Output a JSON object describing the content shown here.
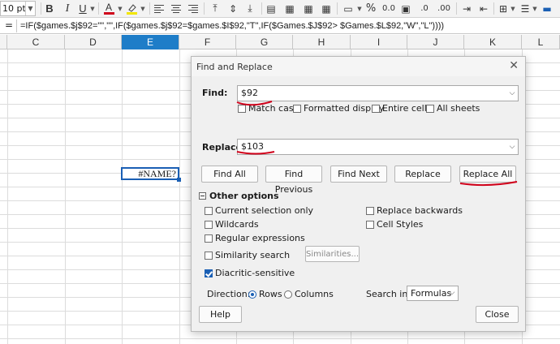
{
  "toolbar": {
    "font_size": "10 pt",
    "bold": "B",
    "italic": "I",
    "underline": "U",
    "font_color_letter": "A",
    "percent": "%",
    "decimal_format": "0.0",
    "decimal_add": ".0",
    "decimal_remove": ".00"
  },
  "formula_bar": {
    "equals": "=",
    "formula": "=IF($games.$j$92=\"\",\"\",IF($games.$j$92=$games.$I$92,\"T\",IF($Games.$J$92> $Games.$L$92,\"W\",\"L\"))))"
  },
  "columns": [
    "C",
    "D",
    "E",
    "F",
    "G",
    "H",
    "I",
    "J",
    "K",
    "L"
  ],
  "active_column": "E",
  "cell": {
    "value": "#NAME?"
  },
  "dialog": {
    "title": "Find and Replace",
    "find_label": "Find:",
    "find_value": "$92",
    "replace_label": "Replace:",
    "replace_value": "$103",
    "checkboxes": {
      "match_case": "Match case",
      "formatted_display": "Formatted display",
      "entire_cells": "Entire cells",
      "all_sheets": "All sheets"
    },
    "buttons": {
      "find_all": "Find All",
      "find_previous": "Find Previous",
      "find_next": "Find Next",
      "replace": "Replace",
      "replace_all": "Replace All",
      "similarities": "Similarities...",
      "help": "Help",
      "close": "Close"
    },
    "other_options": {
      "title": "Other options",
      "current_selection_only": "Current selection only",
      "wildcards": "Wildcards",
      "regular_expressions": "Regular expressions",
      "similarity_search": "Similarity search",
      "diacritic_sensitive": "Diacritic-sensitive",
      "replace_backwards": "Replace backwards",
      "cell_styles": "Cell Styles"
    },
    "direction": {
      "label": "Direction:",
      "rows": "Rows",
      "columns": "Columns",
      "selected": "Rows"
    },
    "search_in": {
      "label": "Search in:",
      "value": "Formulas"
    }
  },
  "colors": {
    "accent": "#1a5fb4",
    "annotation": "#d0021b",
    "header_active": "#1e7dc8"
  }
}
